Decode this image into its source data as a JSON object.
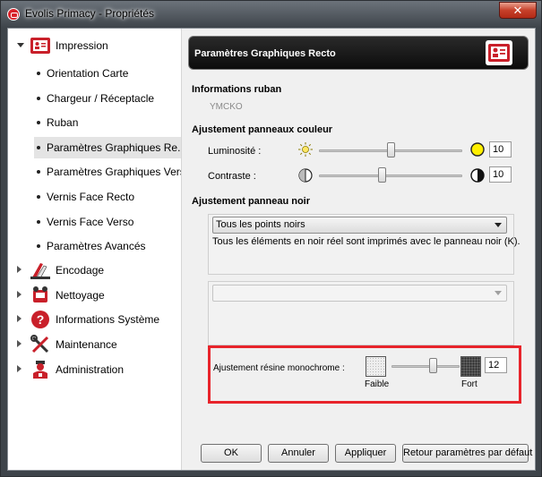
{
  "window": {
    "title": "Evolis Primacy - Propriétés",
    "close_label": "✕"
  },
  "tree": {
    "impression": {
      "label": "Impression",
      "items": [
        {
          "label": "Orientation Carte"
        },
        {
          "label": "Chargeur / Réceptacle"
        },
        {
          "label": "Ruban"
        },
        {
          "label": "Paramètres Graphiques Re..."
        },
        {
          "label": "Paramètres Graphiques Vers..."
        },
        {
          "label": "Vernis Face Recto"
        },
        {
          "label": "Vernis Face Verso"
        },
        {
          "label": "Paramètres Avancés"
        }
      ]
    },
    "groups": [
      {
        "label": "Encodage",
        "icon": "encoding-icon"
      },
      {
        "label": "Nettoyage",
        "icon": "cleaning-icon"
      },
      {
        "label": "Informations Système",
        "icon": "help-icon"
      },
      {
        "label": "Maintenance",
        "icon": "tools-icon"
      },
      {
        "label": "Administration",
        "icon": "admin-icon"
      }
    ]
  },
  "panel": {
    "header_title": "Paramètres Graphiques Recto",
    "ribbon_section": "Informations ruban",
    "ribbon_value": "YMCKO",
    "color_section": "Ajustement panneaux couleur",
    "brightness": {
      "label": "Luminosité :",
      "value": "10",
      "level": 0.5
    },
    "contrast": {
      "label": "Contraste :",
      "value": "10",
      "level": 0.44
    },
    "black_section": "Ajustement panneau noir",
    "black_mode": {
      "selected": "Tous les points noirs",
      "description": "Tous les éléments en noir réel sont imprimés avec le panneau noir (K)."
    },
    "second_combo": {
      "selected": ""
    },
    "resin": {
      "label": "Ajustement résine monochrome :",
      "low": "Faible",
      "high": "Fort",
      "value": "12",
      "level": 0.6
    }
  },
  "buttons": {
    "ok": "OK",
    "cancel": "Annuler",
    "apply": "Appliquer",
    "reset": "Retour paramètres par défaut"
  },
  "colors": {
    "accent": "#d8222a",
    "highlight": "#e8242b",
    "header_bg": "#111111"
  }
}
